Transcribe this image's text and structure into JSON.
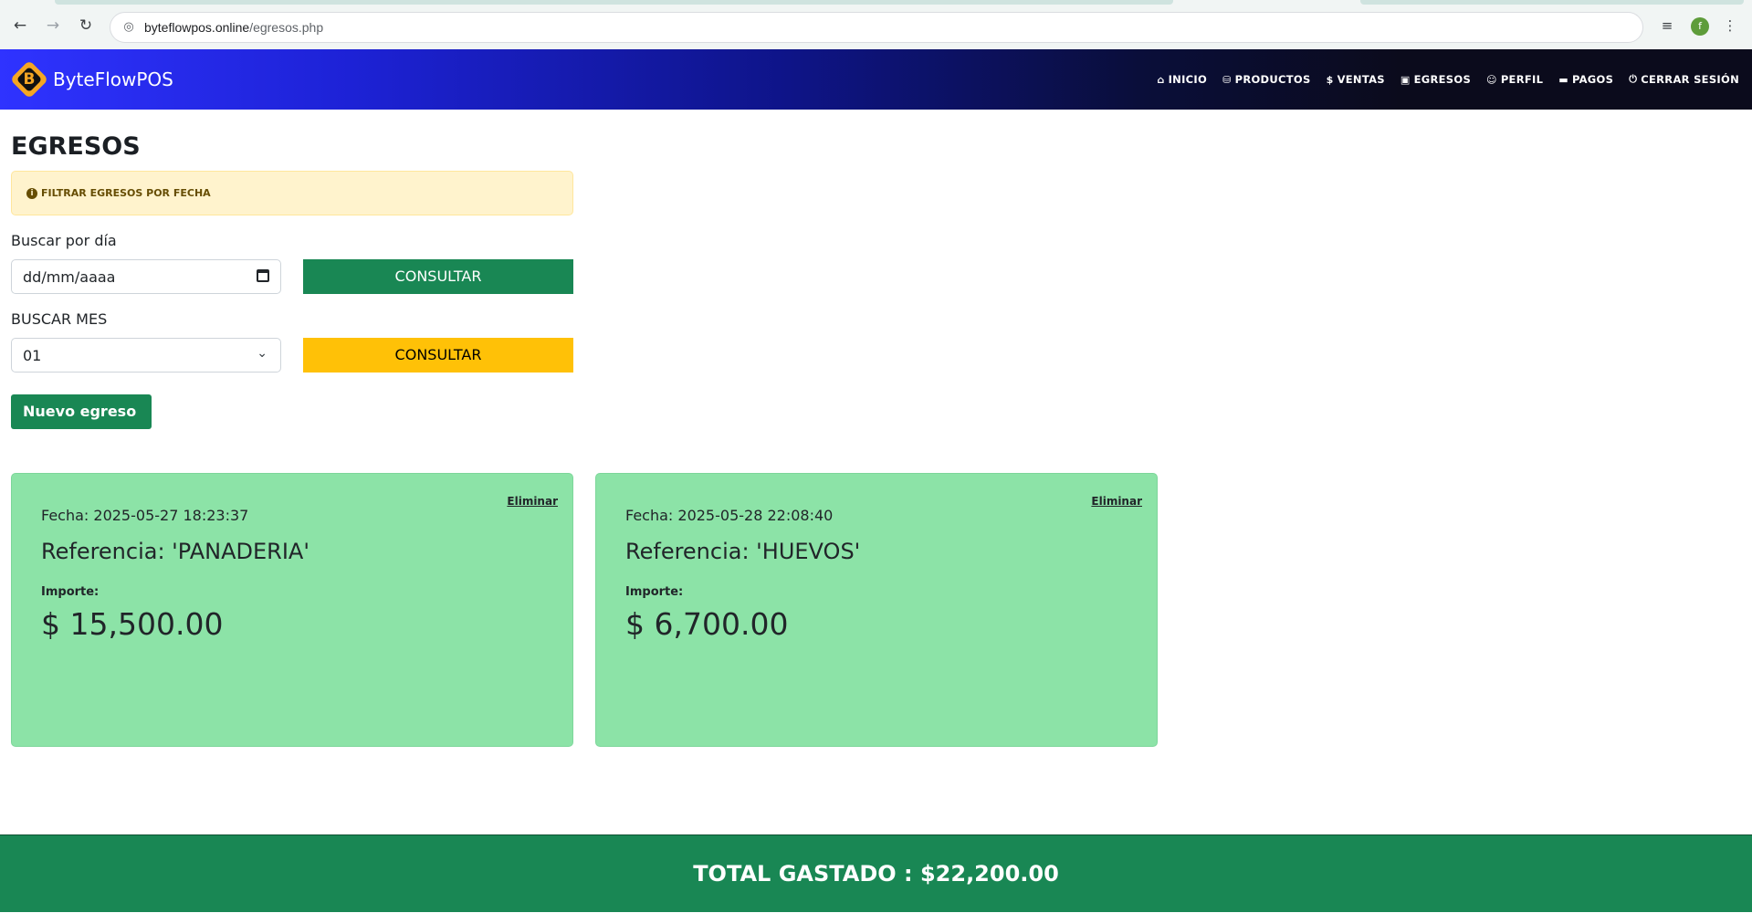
{
  "browser": {
    "url_host": "byteflowpos.online",
    "url_path": "/egresos.php",
    "profile_initial": "f"
  },
  "navbar": {
    "brand_letter": "B",
    "brand_name": "ByteFlowPOS",
    "links": [
      {
        "icon": "home-icon",
        "glyph": "⌂",
        "label": "INICIO"
      },
      {
        "icon": "basket-icon",
        "glyph": "⛁",
        "label": "PRODUCTOS"
      },
      {
        "icon": "dollar-icon",
        "glyph": "$",
        "label": "VENTAS"
      },
      {
        "icon": "cash-icon",
        "glyph": "▣",
        "label": "EGRESOS"
      },
      {
        "icon": "user-icon",
        "glyph": "☺",
        "label": "PERFIL"
      },
      {
        "icon": "card-icon",
        "glyph": "▬",
        "label": "PAGOS"
      },
      {
        "icon": "power-icon",
        "glyph": "⏻",
        "label": "CERRAR SESIÓN"
      }
    ]
  },
  "page": {
    "title": "EGRESOS",
    "alert_text": "FILTRAR EGRESOS POR FECHA",
    "day_label": "Buscar por día",
    "day_placeholder": "dd/mm/aaaa",
    "day_button": "CONSULTAR",
    "month_label": "BUSCAR MES",
    "month_selected": "01",
    "month_button": "CONSULTAR",
    "new_button": "Nuevo egreso +"
  },
  "expenses": [
    {
      "delete_label": "Eliminar",
      "fecha": "Fecha: 2025-05-27 18:23:37",
      "referencia": "Referencia: 'PANADERIA'",
      "importe_label": "Importe:",
      "importe": "$ 15,500.00"
    },
    {
      "delete_label": "Eliminar",
      "fecha": "Fecha: 2025-05-28 22:08:40",
      "referencia": "Referencia: 'HUEVOS'",
      "importe_label": "Importe:",
      "importe": "$ 6,700.00"
    }
  ],
  "footer": {
    "total_text": "TOTAL GASTADO : $22,200.00"
  },
  "colors": {
    "primary_green": "#198754",
    "warning_yellow": "#ffc107",
    "card_green": "#8ce3a7",
    "alert_bg": "#fff3cd"
  }
}
